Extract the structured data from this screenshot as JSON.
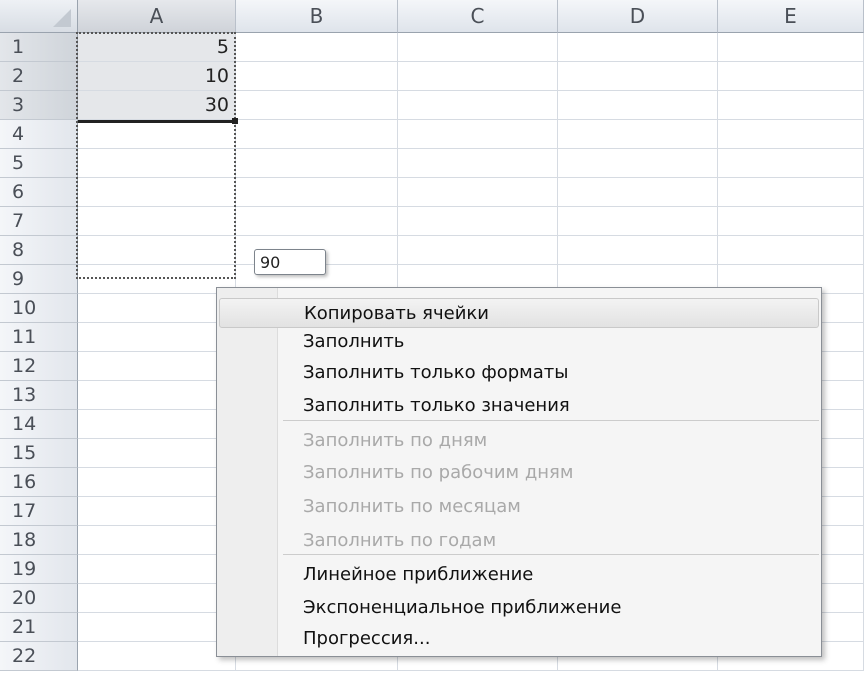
{
  "columns": [
    "A",
    "B",
    "C",
    "D",
    "E"
  ],
  "rows": [
    "1",
    "2",
    "3",
    "4",
    "5",
    "6",
    "7",
    "8",
    "9",
    "10",
    "11",
    "12",
    "13",
    "14",
    "15",
    "16",
    "17",
    "18",
    "19",
    "20",
    "21",
    "22"
  ],
  "cells": {
    "A1": "5",
    "A2": "10",
    "A3": "30"
  },
  "selected_column": "A",
  "selected_rows": [
    "1",
    "2",
    "3"
  ],
  "sum_tooltip": "90",
  "context_menu": {
    "items": [
      {
        "label": "Копировать ячейки",
        "enabled": true,
        "highlighted": true
      },
      {
        "label": "Заполнить",
        "enabled": true
      },
      {
        "label": "Заполнить только форматы",
        "enabled": true
      },
      {
        "label": "Заполнить только значения",
        "enabled": true
      },
      {
        "label": "Заполнить по дням",
        "enabled": false
      },
      {
        "label": "Заполнить по рабочим дням",
        "enabled": false
      },
      {
        "label": "Заполнить по месяцам",
        "enabled": false
      },
      {
        "label": "Заполнить по годам",
        "enabled": false
      },
      {
        "label": "Линейное приближение",
        "enabled": true
      },
      {
        "label": "Экспоненциальное приближение",
        "enabled": true
      },
      {
        "label": "Прогрессия...",
        "enabled": true
      }
    ]
  },
  "colors": {
    "header_bg": "#e4e8ee",
    "grid_line": "#d6dbe2",
    "selection_bg": "#e5e7ea",
    "menu_bg": "#f5f5f5",
    "disabled_text": "#a9a9a9"
  }
}
